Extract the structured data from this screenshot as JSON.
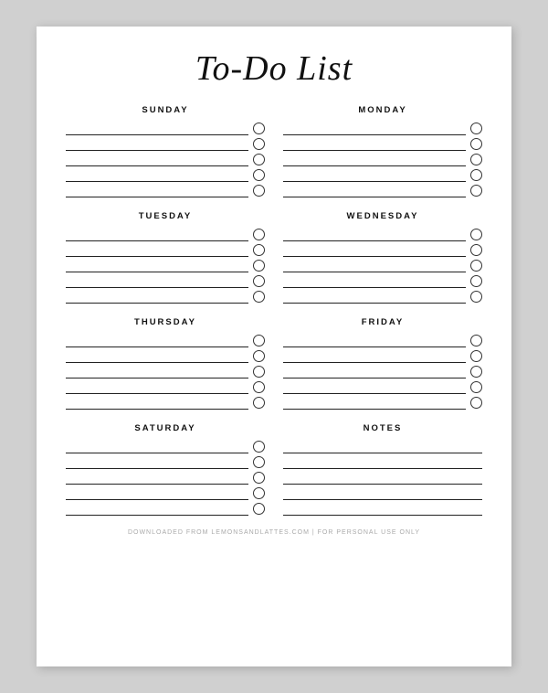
{
  "title": "To-Do List",
  "days": [
    {
      "label": "SUNDAY",
      "rows": 5
    },
    {
      "label": "MONDAY",
      "rows": 5
    },
    {
      "label": "TUESDAY",
      "rows": 5
    },
    {
      "label": "WEDNESDAY",
      "rows": 5
    },
    {
      "label": "THURSDAY",
      "rows": 5
    },
    {
      "label": "FRIDAY",
      "rows": 5
    },
    {
      "label": "SATURDAY",
      "rows": 5
    },
    {
      "label": "NOTES",
      "rows": 5,
      "isNotes": true
    }
  ],
  "footer": "DOWNLOADED FROM LEMONSANDLATTES.COM | FOR PERSONAL USE ONLY"
}
